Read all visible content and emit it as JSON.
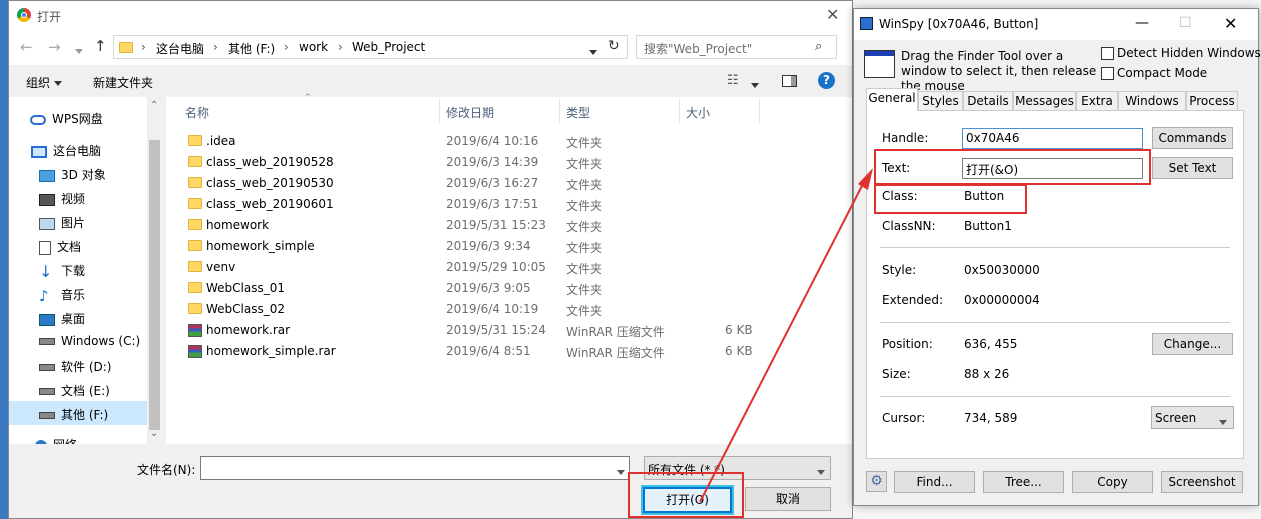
{
  "dialog": {
    "title": "打开",
    "path": [
      "这台电脑",
      "其他 (F:)",
      "work",
      "Web_Project"
    ],
    "search_placeholder": "搜索\"Web_Project\"",
    "organize": "组织",
    "new_folder": "新建文件夹",
    "columns": {
      "name": "名称",
      "date": "修改日期",
      "type": "类型",
      "size": "大小"
    },
    "files": [
      {
        "name": ".idea",
        "date": "2019/6/4 10:16",
        "type": "文件夹",
        "size": "",
        "kind": "folder"
      },
      {
        "name": "class_web_20190528",
        "date": "2019/6/3 14:39",
        "type": "文件夹",
        "size": "",
        "kind": "folder"
      },
      {
        "name": "class_web_20190530",
        "date": "2019/6/3 16:27",
        "type": "文件夹",
        "size": "",
        "kind": "folder"
      },
      {
        "name": "class_web_20190601",
        "date": "2019/6/3 17:51",
        "type": "文件夹",
        "size": "",
        "kind": "folder"
      },
      {
        "name": "homework",
        "date": "2019/5/31 15:23",
        "type": "文件夹",
        "size": "",
        "kind": "folder"
      },
      {
        "name": "homework_simple",
        "date": "2019/6/3 9:34",
        "type": "文件夹",
        "size": "",
        "kind": "folder"
      },
      {
        "name": "venv",
        "date": "2019/5/29 10:05",
        "type": "文件夹",
        "size": "",
        "kind": "folder"
      },
      {
        "name": "WebClass_01",
        "date": "2019/6/3 9:05",
        "type": "文件夹",
        "size": "",
        "kind": "folder"
      },
      {
        "name": "WebClass_02",
        "date": "2019/6/4 10:19",
        "type": "文件夹",
        "size": "",
        "kind": "folder"
      },
      {
        "name": "homework.rar",
        "date": "2019/5/31 15:24",
        "type": "WinRAR 压缩文件",
        "size": "6 KB",
        "kind": "rar"
      },
      {
        "name": "homework_simple.rar",
        "date": "2019/6/4 8:51",
        "type": "WinRAR 压缩文件",
        "size": "6 KB",
        "kind": "rar"
      }
    ],
    "sidebar": [
      {
        "label": "WPS网盘",
        "icon": "cloud-icon"
      },
      {
        "label": "这台电脑",
        "icon": "computer-icon"
      },
      {
        "label": "3D 对象",
        "icon": "cube-icon"
      },
      {
        "label": "视频",
        "icon": "video-icon"
      },
      {
        "label": "图片",
        "icon": "picture-icon"
      },
      {
        "label": "文档",
        "icon": "document-icon"
      },
      {
        "label": "下载",
        "icon": "download-icon"
      },
      {
        "label": "音乐",
        "icon": "music-icon"
      },
      {
        "label": "桌面",
        "icon": "desktop-icon"
      },
      {
        "label": "Windows (C:)",
        "icon": "drive-icon"
      },
      {
        "label": "软件 (D:)",
        "icon": "drive-icon"
      },
      {
        "label": "文档 (E:)",
        "icon": "drive-icon"
      },
      {
        "label": "其他 (F:)",
        "icon": "drive-icon"
      },
      {
        "label": "网络",
        "icon": "network-icon"
      }
    ],
    "filename_label": "文件名(N):",
    "filename_value": "",
    "filter": "所有文件 (*.*)",
    "open_btn": "打开(O)",
    "cancel_btn": "取消"
  },
  "winspy": {
    "title": "WinSpy [0x70A46, Button]",
    "finder_text": "Drag the Finder Tool over a window to select it, then release the mouse",
    "detect_hidden": "Detect Hidden Windows",
    "compact_mode": "Compact Mode",
    "tabs": [
      "General",
      "Styles",
      "Details",
      "Messages",
      "Extra",
      "Windows",
      "Process"
    ],
    "handle_label": "Handle:",
    "handle_value": "0x70A46",
    "text_label": "Text:",
    "text_value": "打开(&O)",
    "class_label": "Class:",
    "class_value": "Button",
    "classnn_label": "ClassNN:",
    "classnn_value": "Button1",
    "style_label": "Style:",
    "style_value": "0x50030000",
    "extended_label": "Extended:",
    "extended_value": "0x00000004",
    "position_label": "Position:",
    "position_value": "636, 455",
    "size_label": "Size:",
    "size_value": "88 x 26",
    "cursor_label": "Cursor:",
    "cursor_value": "734, 589",
    "commands_btn": "Commands",
    "settext_btn": "Set Text",
    "change_btn": "Change...",
    "screen_select": "Screen",
    "find_btn": "Find...",
    "tree_btn": "Tree...",
    "copy_btn": "Copy",
    "screenshot_btn": "Screenshot"
  },
  "colors": {
    "accent": "#0078d7",
    "highlight": "#e03030",
    "selected": "#cce8ff"
  }
}
